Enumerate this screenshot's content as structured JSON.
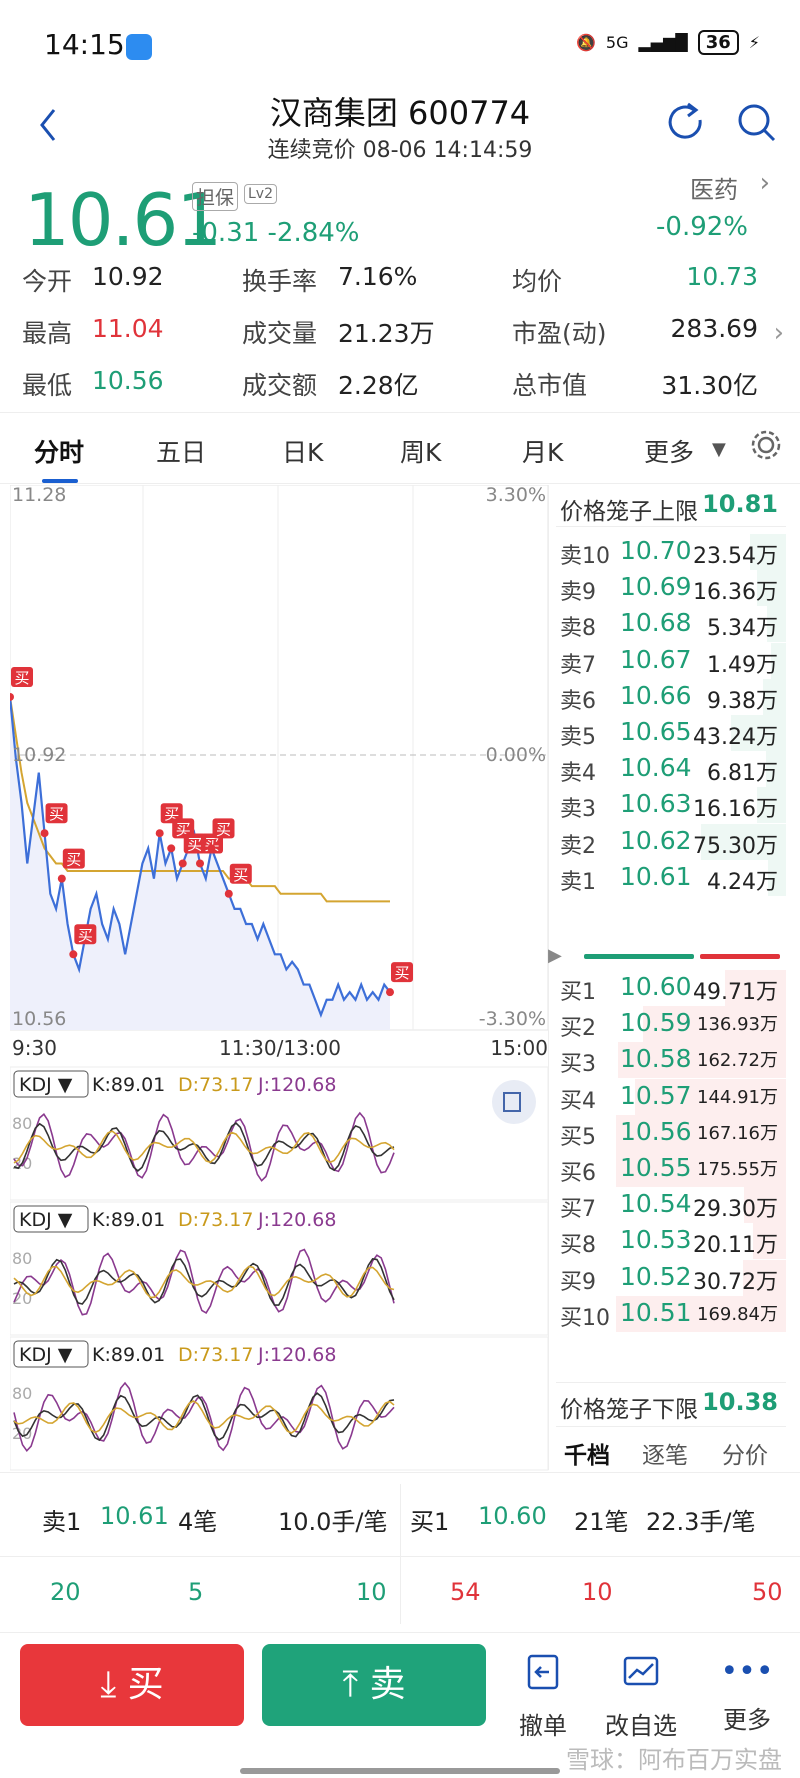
{
  "status": {
    "time": "14:15",
    "network": "5G",
    "battery": "36"
  },
  "header": {
    "title": "汉商集团 600774",
    "subtitle": "连续竞价 08-06 14:14:59"
  },
  "quote": {
    "price": "10.61",
    "tag_margin": "担保",
    "tag_level": "Lv2",
    "change": "-0.31 -2.84%",
    "sector": "医药",
    "sector_change": "-0.92%"
  },
  "stats": [
    [
      {
        "label": "今开",
        "value": "10.92"
      },
      {
        "label": "换手率",
        "value": "7.16%"
      },
      {
        "label": "均价",
        "value": "10.73"
      }
    ],
    [
      {
        "label": "最高",
        "value": "11.04"
      },
      {
        "label": "成交量",
        "value": "21.23万"
      },
      {
        "label": "市盈(动)",
        "value": "283.69"
      }
    ],
    [
      {
        "label": "最低",
        "value": "10.56"
      },
      {
        "label": "成交额",
        "value": "2.28亿"
      },
      {
        "label": "总市值",
        "value": "31.30亿"
      }
    ]
  ],
  "tabs": [
    "分时",
    "五日",
    "日K",
    "周K",
    "月K",
    "更多"
  ],
  "chart": {
    "y_top": "11.28",
    "y_mid": "10.92",
    "y_bot": "10.56",
    "pct_top": "3.30%",
    "pct_mid": "0.00%",
    "pct_bot": "-3.30%",
    "t_start": "9:30",
    "t_mid": "11:30/13:00",
    "t_end": "15:00",
    "marker": "买"
  },
  "kdj": {
    "label": "KDJ",
    "k": "K:89.01",
    "d": "D:73.17",
    "j": "J:120.68",
    "lvl_hi": "80",
    "lvl_lo": "20"
  },
  "book": {
    "upper_label": "价格笼子上限",
    "upper": "10.81",
    "lower_label": "价格笼子下限",
    "lower": "10.38",
    "asks": [
      {
        "l": "卖10",
        "p": "10.70",
        "v": "23.54万"
      },
      {
        "l": "卖9",
        "p": "10.69",
        "v": "16.36万"
      },
      {
        "l": "卖8",
        "p": "10.68",
        "v": "5.34万"
      },
      {
        "l": "卖7",
        "p": "10.67",
        "v": "1.49万"
      },
      {
        "l": "卖6",
        "p": "10.66",
        "v": "9.38万"
      },
      {
        "l": "卖5",
        "p": "10.65",
        "v": "43.24万"
      },
      {
        "l": "卖4",
        "p": "10.64",
        "v": "6.81万"
      },
      {
        "l": "卖3",
        "p": "10.63",
        "v": "16.16万"
      },
      {
        "l": "卖2",
        "p": "10.62",
        "v": "75.30万"
      },
      {
        "l": "卖1",
        "p": "10.61",
        "v": "4.24万"
      }
    ],
    "bids": [
      {
        "l": "买1",
        "p": "10.60",
        "v": "49.71万"
      },
      {
        "l": "买2",
        "p": "10.59",
        "v": "136.93万"
      },
      {
        "l": "买3",
        "p": "10.58",
        "v": "162.72万"
      },
      {
        "l": "买4",
        "p": "10.57",
        "v": "144.91万"
      },
      {
        "l": "买5",
        "p": "10.56",
        "v": "167.16万"
      },
      {
        "l": "买6",
        "p": "10.55",
        "v": "175.55万"
      },
      {
        "l": "买7",
        "p": "10.54",
        "v": "29.30万"
      },
      {
        "l": "买8",
        "p": "10.53",
        "v": "20.11万"
      },
      {
        "l": "买9",
        "p": "10.52",
        "v": "30.72万"
      },
      {
        "l": "买10",
        "p": "10.51",
        "v": "169.84万"
      }
    ],
    "tabs": [
      "千档",
      "逐笔",
      "分价"
    ]
  },
  "queue": {
    "sell": {
      "l": "卖1",
      "p": "10.61",
      "n": "4笔",
      "avg": "10.0手/笔",
      "q": [
        "20",
        "5",
        "10"
      ]
    },
    "buy": {
      "l": "买1",
      "p": "10.60",
      "n": "21笔",
      "avg": "22.3手/笔",
      "q": [
        "54",
        "10",
        "50"
      ]
    }
  },
  "actions": {
    "buy": "买",
    "sell": "卖",
    "cancel": "撤单",
    "edit_watch": "改自选",
    "more": "更多"
  },
  "watermark": "雪球：阿布百万实盘"
}
